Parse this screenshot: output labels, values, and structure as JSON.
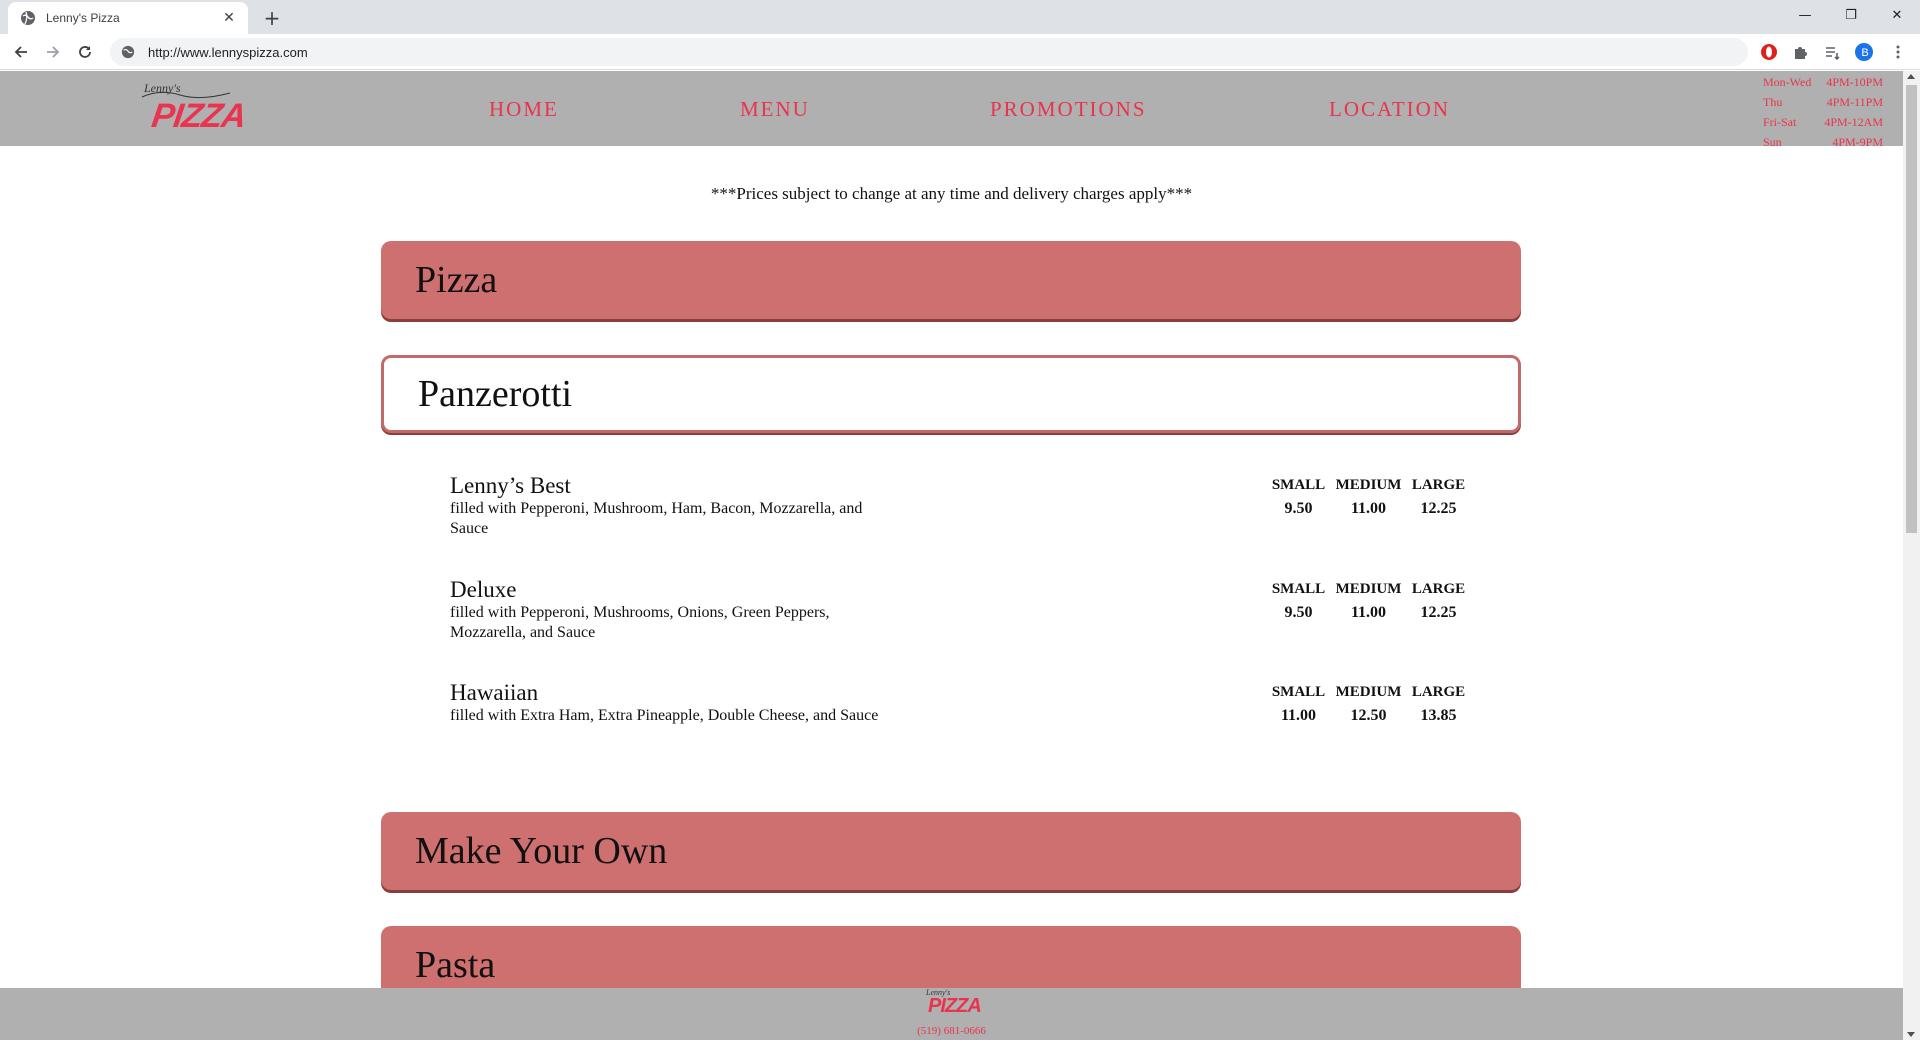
{
  "browser": {
    "tab_title": "Lenny's Pizza",
    "close_glyph": "✕",
    "new_tab_glyph": "+",
    "url": "http://www.lennyspizza.com",
    "window_controls": {
      "minimize": "—",
      "restore": "❐",
      "close": "✕"
    },
    "profile_initial": "B"
  },
  "site": {
    "logo": {
      "script": "Lenny's",
      "main": "PIZZA"
    },
    "nav": [
      {
        "label": "HOME"
      },
      {
        "label": "MENU"
      },
      {
        "label": "PROMOTIONS"
      },
      {
        "label": "LOCATION"
      }
    ],
    "hours": [
      {
        "days": "Mon-Wed",
        "time": "4PM-10PM"
      },
      {
        "days": "Thu",
        "time": "4PM-11PM"
      },
      {
        "days": "Fri-Sat",
        "time": "4PM-12AM"
      },
      {
        "days": "Sun",
        "time": "4PM-9PM"
      }
    ],
    "notice": "***Prices subject to change at any time and delivery charges apply***",
    "sections": [
      {
        "title": "Pizza",
        "state": "collapsed"
      },
      {
        "title": "Panzerotti",
        "state": "expanded"
      },
      {
        "title": "Make Your Own",
        "state": "collapsed"
      },
      {
        "title": "Pasta",
        "state": "collapsed"
      }
    ],
    "size_headers": {
      "small": "SMALL",
      "medium": "MEDIUM",
      "large": "LARGE"
    },
    "panzerotti_items": [
      {
        "name": "Lenny’s Best",
        "desc": "filled with Pepperoni, Mushroom, Ham, Bacon, Mozzarella, and Sauce",
        "small": "9.50",
        "medium": "11.00",
        "large": "12.25"
      },
      {
        "name": "Deluxe",
        "desc": "filled with Pepperoni, Mushrooms, Onions, Green Peppers, Mozzarella, and Sauce",
        "small": "9.50",
        "medium": "11.00",
        "large": "12.25"
      },
      {
        "name": "Hawaiian",
        "desc": "filled with Extra Ham, Extra Pineapple, Double Cheese, and Sauce",
        "small": "11.00",
        "medium": "12.50",
        "large": "13.85"
      }
    ],
    "footer": {
      "logo_script": "Lenny's",
      "logo_main": "PIZZA",
      "phone": "(519) 681-0666"
    }
  },
  "colors": {
    "accent_red": "#e8344e",
    "section_bar": "#cf7070",
    "header_gray": "#b0b0b0"
  }
}
